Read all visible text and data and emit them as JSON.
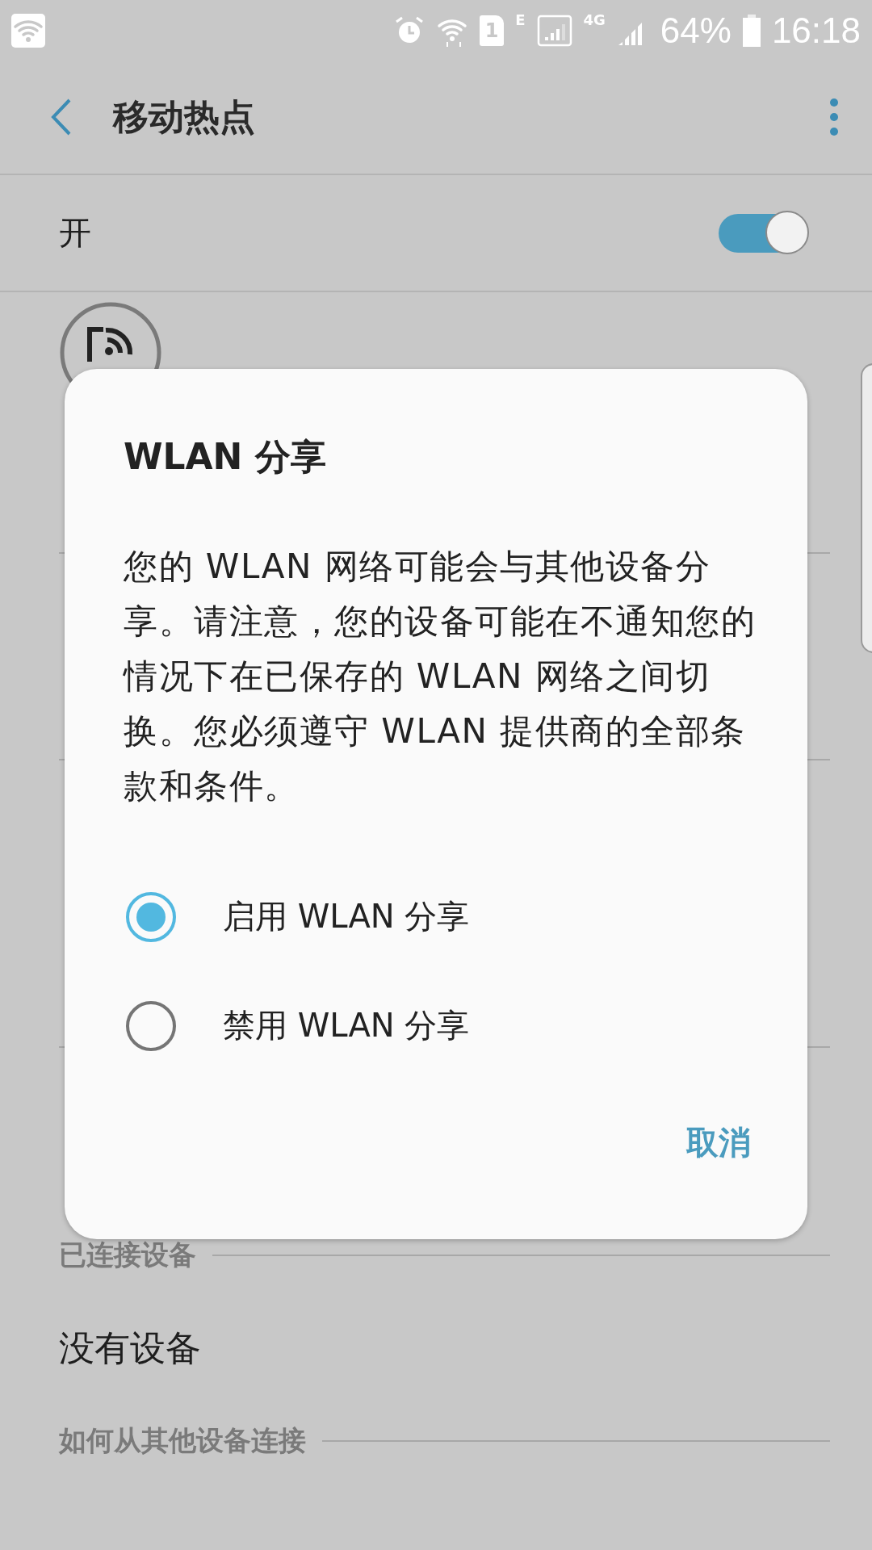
{
  "status_bar": {
    "sim": "1",
    "network_1": "E",
    "network_2": "4G",
    "battery": "64%",
    "time": "16:18"
  },
  "header": {
    "title": "移动热点"
  },
  "master_switch": {
    "label": "开",
    "on": true
  },
  "sections": [
    {
      "title": "已连接设备",
      "items": [
        "没有设备"
      ]
    },
    {
      "title": "如何从其他设备连接"
    }
  ],
  "dialog": {
    "title": "WLAN 分享",
    "message": "您的 WLAN 网络可能会与其他设备分享。请注意，您的设备可能在不通知您的情况下在已保存的 WLAN 网络之间切换。您必须遵守 WLAN 提供商的全部条款和条件。",
    "options": [
      {
        "label": "启用 WLAN 分享",
        "selected": true
      },
      {
        "label": "禁用 WLAN 分享",
        "selected": false
      }
    ],
    "buttons": [
      "取消"
    ]
  }
}
